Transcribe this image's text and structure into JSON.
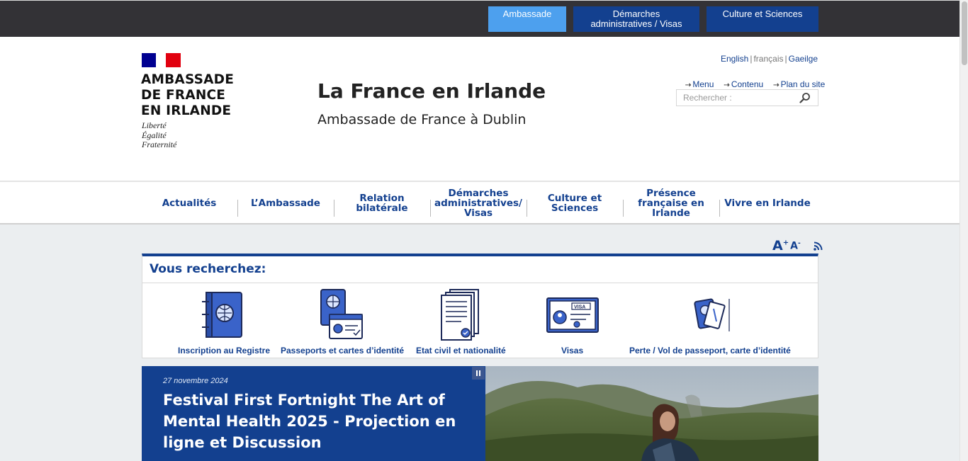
{
  "topbar": {
    "links": [
      "Ambassade",
      "Démarches\nadministratives / Visas",
      "Culture et Sciences"
    ]
  },
  "header": {
    "institution_lines": [
      "AMBASSADE",
      "DE FRANCE",
      "EN IRLANDE"
    ],
    "motto_lines": [
      "Liberté",
      "Égalité",
      "Fraternité"
    ],
    "title": "La France en Irlande",
    "subtitle": "Ambassade de France à Dublin",
    "languages": [
      "English",
      "français",
      "Gaeilge"
    ],
    "quick_links": [
      "Menu",
      "Contenu",
      "Plan du site"
    ],
    "search_placeholder": "Rechercher :"
  },
  "nav": {
    "items": [
      "Actualités",
      "L’Ambassade",
      "Relation bilatérale",
      "Démarches administratives/ Visas",
      "Culture et Sciences",
      "Présence française en Irlande",
      "Vivre en Irlande"
    ]
  },
  "tools": {
    "font_increase": "A",
    "font_decrease": "A"
  },
  "quick_search": {
    "title": "Vous recherchez:",
    "tiles": [
      {
        "label": "Inscription au Registre",
        "icon": "registry-book-icon"
      },
      {
        "label": "Passeports et cartes d’identité",
        "icon": "passport-id-icon"
      },
      {
        "label": "Etat civil et nationalité",
        "icon": "civil-status-document-icon"
      },
      {
        "label": "Visas",
        "icon": "visa-card-icon"
      },
      {
        "label": "Perte / Vol de passeport, carte d’identité",
        "icon": "lost-passport-icon"
      }
    ]
  },
  "news": {
    "date": "27 novembre 2024",
    "title": "Festival First Fortnight The Art of Mental Health 2025 - Projection en ligne et Discussion"
  },
  "colors": {
    "brand_blue": "#13408f",
    "topbar_active": "#4da0ee",
    "topbar_bg": "#333236"
  }
}
